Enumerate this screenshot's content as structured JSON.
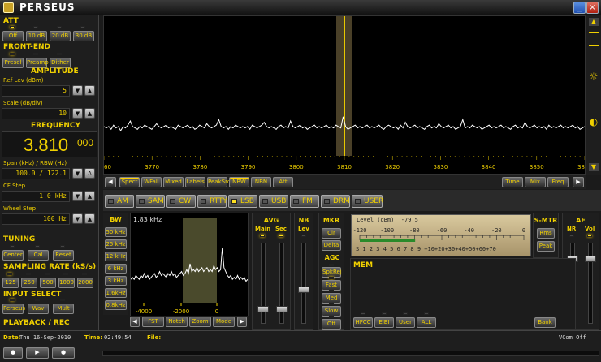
{
  "app": {
    "title": "PERSEUS"
  },
  "att": {
    "title": "ATT",
    "buttons": [
      "Off",
      "10 dB",
      "20 dB",
      "30 dB"
    ],
    "active_index": 0
  },
  "frontend": {
    "title": "FRONT-END",
    "buttons": [
      "Presel",
      "Preamp",
      "Dither"
    ],
    "active": [
      true,
      false,
      false
    ]
  },
  "amplitude": {
    "title": "AMPLITUDE",
    "ref_label": "Ref Lev (dBm)",
    "ref_value": "5",
    "scale_label": "Scale (dB/div)",
    "scale_value": "10"
  },
  "frequency": {
    "title": "FREQUENCY",
    "main": "3.810",
    "fine": "000",
    "span_label": "Span (kHz) / RBW (Hz)",
    "span_value": "100.0 / 122.1",
    "cf_label": "CF Step",
    "cf_value": "1.0 kHz",
    "wheel_label": "Wheel Step",
    "wheel_value": "100 Hz"
  },
  "tuning": {
    "title": "TUNING",
    "buttons": [
      "Center",
      "Cal",
      "Reset"
    ]
  },
  "sampling": {
    "title": "SAMPLING RATE (kS/s)",
    "buttons": [
      "125",
      "250",
      "500",
      "1000",
      "2000"
    ],
    "active_index": 0
  },
  "input": {
    "title": "INPUT SELECT",
    "buttons": [
      "Perseus",
      "Wav",
      "Mult"
    ],
    "active_index": 0
  },
  "playback": {
    "title": "PLAYBACK / REC",
    "date_label": "Date:",
    "date": "Thu 16-Sep-2010",
    "time_label": "Time:",
    "time": "02:49:54",
    "file_label": "File:",
    "file": "",
    "status": "VCom Off"
  },
  "spectrum": {
    "x_ticks": [
      "60",
      "3770",
      "3780",
      "3790",
      "3800",
      "3810",
      "3820",
      "3830",
      "3840",
      "3850",
      "38"
    ],
    "center_label": "3810",
    "trace": [
      -79,
      -80,
      -79,
      -81,
      -78,
      -80,
      -79,
      -82,
      -79,
      -80,
      -78,
      -75,
      -79,
      -80,
      -81,
      -79,
      -80,
      -78,
      -79,
      -80,
      -81,
      -79,
      -77,
      -79,
      -80,
      -79,
      -78,
      -80,
      -79,
      -80,
      -81,
      -78,
      -79,
      -80,
      -79,
      -78,
      -80,
      -79,
      -81,
      -80,
      -78,
      -79,
      -80,
      -77,
      -79,
      -80,
      -79,
      -78,
      -74,
      -79,
      -80,
      -79,
      -81,
      -79,
      -80,
      -78,
      -79,
      -80,
      -79,
      -80,
      -79,
      -81,
      -78,
      -79,
      -80,
      -79,
      -78,
      -76,
      -79,
      -80,
      -79,
      -80,
      -81,
      -79,
      -78,
      -80,
      -79,
      -80,
      -75,
      -79,
      -80,
      -79,
      -78,
      -80,
      -79,
      -81,
      -80,
      -79,
      -78,
      -80,
      -79,
      -80,
      -79,
      -78,
      -80,
      -79,
      -80,
      -78,
      -79,
      -80,
      -72,
      -79,
      -81,
      -80,
      -79,
      -78,
      -80,
      -79,
      -80,
      -79,
      -78,
      -80,
      -79,
      -80,
      -79,
      -78,
      -80,
      -81,
      -79,
      -78,
      -79,
      -80,
      -79,
      -81,
      -78,
      -80,
      -76,
      -79,
      -80,
      -79,
      -78,
      -80,
      -79,
      -80,
      -81,
      -79,
      -78,
      -80,
      -79,
      -80,
      -77,
      -79,
      -80,
      -79,
      -78,
      -80,
      -79,
      -81,
      -80,
      -79,
      -74,
      -80,
      -79,
      -80,
      -78,
      -79,
      -80,
      -79,
      -81,
      -80,
      -79,
      -78,
      -80,
      -79,
      -80,
      -79,
      -78,
      -80,
      -79,
      -80,
      -81,
      -79,
      -78,
      -80,
      -79,
      -80,
      -76,
      -79,
      -80,
      -79,
      -78,
      -80,
      -79,
      -80,
      -79,
      -81,
      -78,
      -80,
      -79,
      -80,
      -79,
      -78,
      -80,
      -79,
      -80,
      -79,
      -78,
      -80,
      -79,
      -81,
      -80,
      -79
    ],
    "y_min": -100,
    "y_max": 0
  },
  "toolbar_left": [
    "Spect",
    "WFall",
    "Mixed",
    "Labels",
    "PeakSrc",
    "NBW",
    "NBN",
    "Att"
  ],
  "toolbar_left_active": [
    true,
    false,
    false,
    false,
    false,
    true,
    false,
    false
  ],
  "toolbar_right": [
    "Time",
    "Mix",
    "Freq"
  ],
  "modes": [
    "AM",
    "SAM",
    "CW",
    "RTTY",
    "LSB",
    "USB",
    "FM",
    "DRM",
    "USER"
  ],
  "mode_active_index": 4,
  "bw": {
    "title": "BW",
    "value": "1.83 kHz",
    "buttons": [
      "50 kHz",
      "25 kHz",
      "12 kHz",
      "6 kHz",
      "3 kHz",
      "1.6kHz",
      "0.8kHz"
    ]
  },
  "filter": {
    "x_ticks": [
      "-4000",
      "-2000",
      "0"
    ],
    "buttons": [
      "FST",
      "Notch",
      "Zoom",
      "Mode"
    ],
    "trace": [
      -88,
      -87,
      -88,
      -86,
      -87,
      -88,
      -86,
      -87,
      -85,
      -87,
      -86,
      -88,
      -87,
      -86,
      -85,
      -87,
      -86,
      -84,
      -86,
      -85,
      -86,
      -87,
      -85,
      -86,
      -84,
      -86,
      -85,
      -87,
      -86,
      -85,
      -84,
      -86,
      -85,
      -83,
      -85,
      -80,
      -84,
      -83,
      -84,
      -82,
      -84,
      -83,
      -82,
      -84,
      -83,
      -82,
      -84,
      -83,
      -84,
      -81,
      -83,
      -82,
      -84,
      -83,
      -72,
      -82,
      -84,
      -86,
      -87,
      -86,
      -88,
      -87,
      -88,
      -86,
      -88,
      -87,
      -88,
      -87,
      -89,
      -88
    ],
    "y_min": -100,
    "y_max": -60
  },
  "avg": {
    "title": "AVG",
    "labels": [
      "Main",
      "Sec"
    ],
    "active": [
      true,
      true
    ]
  },
  "nb": {
    "title": "NB",
    "label": "Lev",
    "active": false
  },
  "mkr": {
    "title": "MKR",
    "buttons": [
      "Clr",
      "Delta"
    ]
  },
  "agc": {
    "title": "AGC",
    "buttons": [
      "SpkRej",
      "Fast",
      "Med",
      "Slow",
      "Off"
    ],
    "active": [
      false,
      true,
      false,
      false,
      false
    ]
  },
  "smeter": {
    "level_text": "Level (dBm): -79.5",
    "top_scale": [
      "-120",
      "-100",
      "-80",
      "-60",
      "-40",
      "-20",
      "0"
    ],
    "bottom_scale": "S 1 2 3 4 5 6 7 8 9 +10+20+30+40+50+60+70",
    "level_dbm": -79.5,
    "title": "S-MTR",
    "buttons": [
      "Rms",
      "Peak"
    ]
  },
  "af": {
    "title": "AF",
    "labels": [
      "NR",
      "Vol"
    ],
    "active": [
      false,
      true
    ]
  },
  "mem": {
    "title": "MEM",
    "buttons": [
      "HFCC",
      "EIBI",
      "User",
      "ALL"
    ],
    "bank": "Bank"
  },
  "colors": {
    "accent": "#f0d000",
    "trace": "#ffffff",
    "center_line": "#e8c800"
  }
}
